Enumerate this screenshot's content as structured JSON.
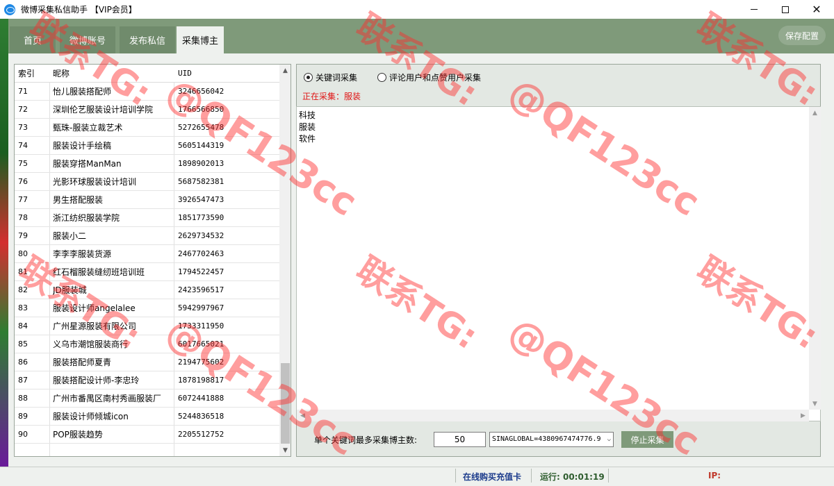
{
  "window": {
    "title": "微博采集私信助手 【VIP会员】",
    "controls": {
      "minimize": "minimize-icon",
      "maximize": "maximize-icon",
      "close": "close-icon"
    }
  },
  "tabs": [
    {
      "label": "首页",
      "active": false
    },
    {
      "label": "微博账号",
      "active": false
    },
    {
      "label": "发布私信",
      "active": false
    },
    {
      "label": "采集博主",
      "active": true
    }
  ],
  "save_button": "保存配置",
  "table": {
    "headers": [
      "索引",
      "昵称",
      "UID"
    ],
    "rows": [
      {
        "index": "71",
        "nickname": "怡儿服装搭配师",
        "uid": "3246656042"
      },
      {
        "index": "72",
        "nickname": "深圳伦艺服装设计培训学院",
        "uid": "1766566850"
      },
      {
        "index": "73",
        "nickname": "甄珠-服装立裁艺术",
        "uid": "5272655478"
      },
      {
        "index": "74",
        "nickname": "服装设计手绘稿",
        "uid": "5605144319"
      },
      {
        "index": "75",
        "nickname": "服装穿搭ManMan",
        "uid": "1898902013"
      },
      {
        "index": "76",
        "nickname": "光影环球服装设计培训",
        "uid": "5687582381"
      },
      {
        "index": "77",
        "nickname": "男生搭配服装",
        "uid": "3926547473"
      },
      {
        "index": "78",
        "nickname": "浙江纺织服装学院",
        "uid": "1851773590"
      },
      {
        "index": "79",
        "nickname": "服装小二",
        "uid": "2629734532"
      },
      {
        "index": "80",
        "nickname": "李李李服装货源",
        "uid": "2467702463"
      },
      {
        "index": "81",
        "nickname": "红石榴服装缝纫班培训班",
        "uid": "1794522457"
      },
      {
        "index": "82",
        "nickname": "JD服装城",
        "uid": "2423596517"
      },
      {
        "index": "83",
        "nickname": "服装设计师angelalee",
        "uid": "5942997967"
      },
      {
        "index": "84",
        "nickname": "广州星源服装有限公司",
        "uid": "1733311950"
      },
      {
        "index": "85",
        "nickname": "义乌市潮馆服装商行",
        "uid": "6017665021"
      },
      {
        "index": "86",
        "nickname": "服装搭配师夏青",
        "uid": "2194775602"
      },
      {
        "index": "87",
        "nickname": "服装搭配设计师-李忠玲",
        "uid": "1878198817"
      },
      {
        "index": "88",
        "nickname": "广州市番禺区南村秀画服装厂",
        "uid": "6072441888"
      },
      {
        "index": "89",
        "nickname": "服装设计师倾城icon",
        "uid": "5244836518"
      },
      {
        "index": "90",
        "nickname": "POP服装趋势",
        "uid": "2205512752"
      }
    ]
  },
  "collect": {
    "mode_keyword": "关键词采集",
    "mode_comment": "评论用户和点赞用户采集",
    "selected_mode": "keyword",
    "status": "正在采集：服装",
    "keywords": [
      "科技",
      "服装",
      "软件"
    ]
  },
  "controls": {
    "max_label": "单个关键词最多采集博主数:",
    "max_value": "50",
    "cookie_value": "SINAGLOBAL=4380967474776.9",
    "stop_button": "停止采集"
  },
  "statusbar": {
    "buy": "在线购买充值卡",
    "running": "运行: 00:01:19",
    "ip": "IP:"
  },
  "watermark": {
    "line1": "联系TG:",
    "line2": "@QF123cc"
  },
  "colors": {
    "toolbar_green": "#7f9a7a",
    "status_red": "#e01414",
    "watermark_red": "#ff2b2b"
  }
}
